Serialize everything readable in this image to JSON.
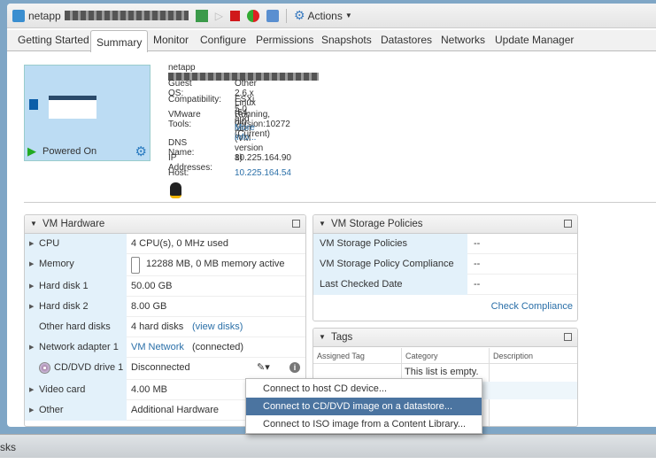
{
  "toolbar": {
    "vm_name": "netapp",
    "actions_label": "Actions"
  },
  "tabs": [
    "Getting Started",
    "Summary",
    "Monitor",
    "Configure",
    "Permissions",
    "Snapshots",
    "Datastores",
    "Networks",
    "Update Manager"
  ],
  "summary": {
    "power_state": "Powered On",
    "vm_name": "netapp",
    "fields": [
      {
        "label": "Guest OS:",
        "value": "Other 2.6.x Linux (64-bit)"
      },
      {
        "label": "Compatibility:",
        "value": "ESXi 5.0 and later (VM version 8)"
      },
      {
        "label": "VMware Tools:",
        "value": "Running, version:10272 (Current)"
      },
      {
        "label": "DNS Name:",
        "value": ""
      },
      {
        "label": "IP Addresses:",
        "value": "10.225.164.90"
      },
      {
        "label": "Host:",
        "value": "10.225.164.54"
      }
    ],
    "more_info": "More info..."
  },
  "vm_hardware": {
    "title": "VM Hardware",
    "rows": [
      {
        "label": "CPU",
        "value": "4 CPU(s), 0 MHz used"
      },
      {
        "label": "Memory",
        "value": "12288 MB, 0 MB memory active"
      },
      {
        "label": "Hard disk 1",
        "value": "50.00 GB"
      },
      {
        "label": "Hard disk 2",
        "value": "8.00 GB"
      },
      {
        "label": "Other hard disks",
        "value": "4 hard disks",
        "link": "(view disks)"
      },
      {
        "label": "Network adapter 1",
        "value": "VM Network",
        "extra": "(connected)"
      },
      {
        "label": "CD/DVD drive 1",
        "value": "Disconnected"
      },
      {
        "label": "Video card",
        "value": "4.00 MB"
      },
      {
        "label": "Other",
        "value": "Additional Hardware"
      }
    ]
  },
  "storage": {
    "title": "VM Storage Policies",
    "rows": [
      {
        "label": "VM Storage Policies",
        "value": "--"
      },
      {
        "label": "VM Storage Policy Compliance",
        "value": "--"
      },
      {
        "label": "Last Checked Date",
        "value": "--"
      }
    ],
    "check_compliance": "Check Compliance"
  },
  "tags": {
    "title": "Tags",
    "columns": [
      "Assigned Tag",
      "Category",
      "Description"
    ],
    "empty": "This list is empty."
  },
  "menu": {
    "items": [
      "Connect to host CD device...",
      "Connect to CD/DVD image on a datastore...",
      "Connect to ISO image from a Content Library..."
    ]
  },
  "bottom": {
    "label": "sks"
  }
}
